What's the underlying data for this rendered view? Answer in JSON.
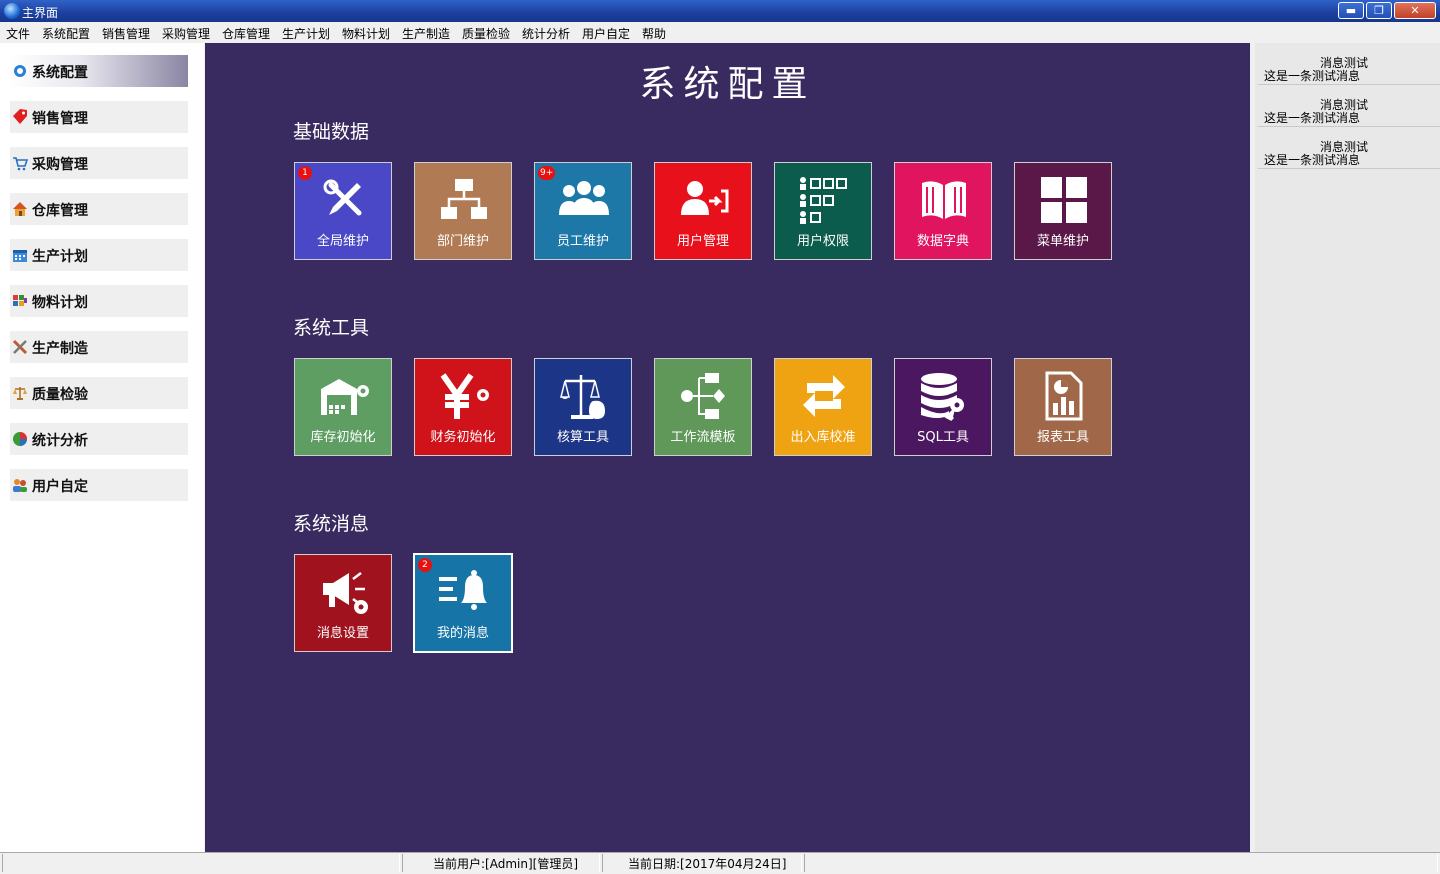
{
  "window": {
    "title": "主界面"
  },
  "menu": [
    "文件",
    "系统配置",
    "销售管理",
    "采购管理",
    "仓库管理",
    "生产计划",
    "物料计划",
    "生产制造",
    "质量检验",
    "统计分析",
    "用户自定",
    "帮助"
  ],
  "sidebar": {
    "items": [
      {
        "label": "系统配置",
        "icon": "gear-icon"
      },
      {
        "label": "销售管理",
        "icon": "tag-icon"
      },
      {
        "label": "采购管理",
        "icon": "cart-icon"
      },
      {
        "label": "仓库管理",
        "icon": "house-icon"
      },
      {
        "label": "生产计划",
        "icon": "calendar-icon"
      },
      {
        "label": "物料计划",
        "icon": "blocks-icon"
      },
      {
        "label": "生产制造",
        "icon": "tools-icon"
      },
      {
        "label": "质量检验",
        "icon": "scale-icon"
      },
      {
        "label": "统计分析",
        "icon": "pie-chart-icon"
      },
      {
        "label": "用户自定",
        "icon": "users-icon"
      }
    ]
  },
  "main": {
    "title": "系统配置",
    "sections": [
      {
        "title": "基础数据",
        "tiles": [
          {
            "label": "全局维护",
            "icon": "tools-icon",
            "color": "#4a48c6",
            "badge": "1"
          },
          {
            "label": "部门维护",
            "icon": "org-chart-icon",
            "color": "#b07a55",
            "badge": ""
          },
          {
            "label": "员工维护",
            "icon": "people-icon",
            "color": "#1d78a8",
            "badge": "9+"
          },
          {
            "label": "用户管理",
            "icon": "user-login-icon",
            "color": "#e8101a",
            "badge": ""
          },
          {
            "label": "用户权限",
            "icon": "checklist-icon",
            "color": "#0b5c4c",
            "badge": ""
          },
          {
            "label": "数据字典",
            "icon": "book-icon",
            "color": "#e0145f",
            "badge": ""
          },
          {
            "label": "菜单维护",
            "icon": "grid-icon",
            "color": "#5a1848",
            "badge": ""
          }
        ]
      },
      {
        "title": "系统工具",
        "tiles": [
          {
            "label": "库存初始化",
            "icon": "warehouse-gear-icon",
            "color": "#5f9e63",
            "badge": ""
          },
          {
            "label": "财务初始化",
            "icon": "yen-gear-icon",
            "color": "#d0121b",
            "badge": ""
          },
          {
            "label": "核算工具",
            "icon": "balance-icon",
            "color": "#1d3586",
            "badge": ""
          },
          {
            "label": "工作流模板",
            "icon": "workflow-icon",
            "color": "#5f9858",
            "badge": ""
          },
          {
            "label": "出入库校准",
            "icon": "refresh-icon",
            "color": "#f0a312",
            "badge": ""
          },
          {
            "label": "SQL工具",
            "icon": "database-key-icon",
            "color": "#4b1760",
            "badge": ""
          },
          {
            "label": "报表工具",
            "icon": "report-icon",
            "color": "#a06848",
            "badge": ""
          }
        ]
      },
      {
        "title": "系统消息",
        "tiles": [
          {
            "label": "消息设置",
            "icon": "megaphone-gear-icon",
            "color": "#a0121e",
            "badge": ""
          },
          {
            "label": "我的消息",
            "icon": "bell-list-icon",
            "color": "#1674a6",
            "badge": "2"
          }
        ]
      }
    ]
  },
  "messages": [
    {
      "title": "消息测试",
      "body": "这是一条测试消息"
    },
    {
      "title": "消息测试",
      "body": "这是一条测试消息"
    },
    {
      "title": "消息测试",
      "body": "这是一条测试消息"
    }
  ],
  "status": {
    "user": "当前用户:[Admin][管理员]",
    "date": "当前日期:[2017年04月24日]"
  }
}
